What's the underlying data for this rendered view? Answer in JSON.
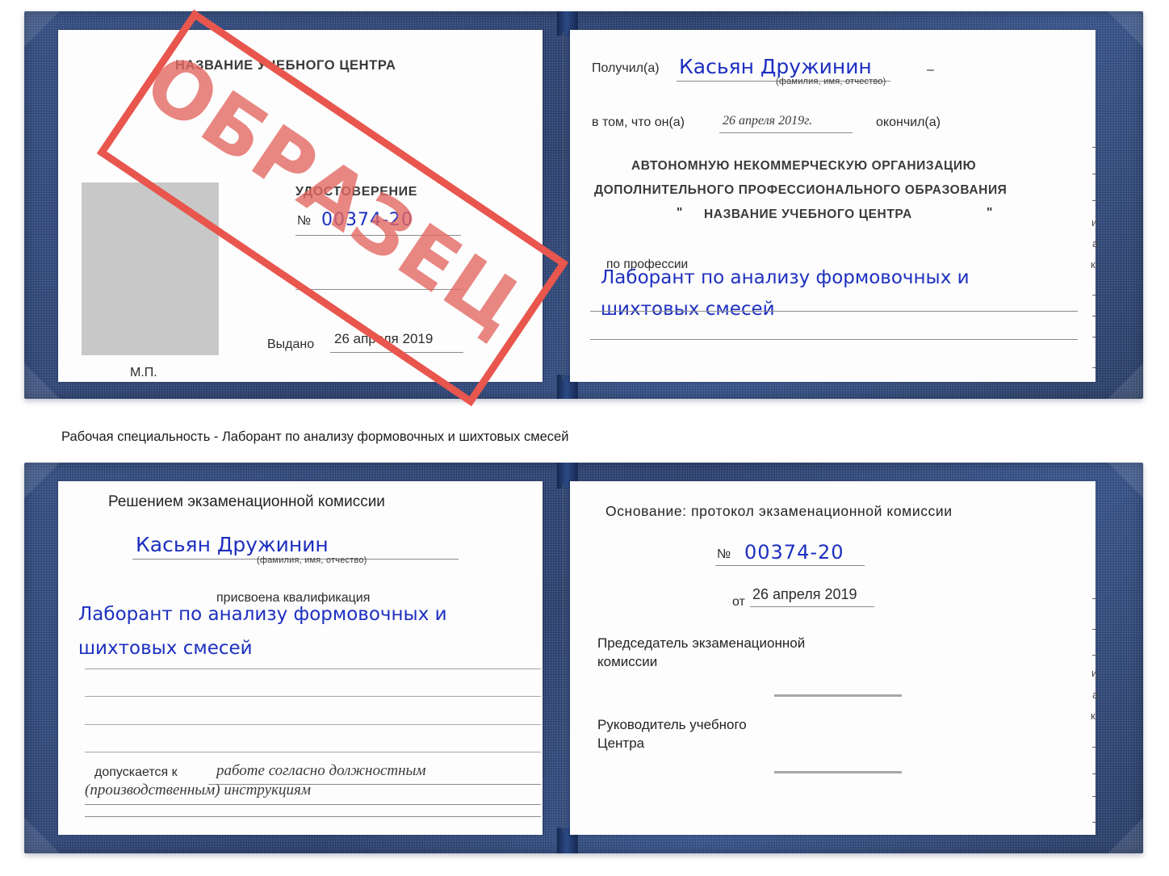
{
  "caption": "Рабочая специальность - Лаборант по анализу формовочных и шихтовых смесей",
  "colors": {
    "cover_blue": "#24407a",
    "stamp_red": "#e8564e",
    "ink_blue": "#1d2fc0",
    "paper": "#fdfdfd",
    "photo_placeholder": "#c8c8c8"
  },
  "stamp": {
    "text": "ОБРАЗЕЦ"
  },
  "certificate_top": {
    "left_page": {
      "center_name": "НАЗВАНИЕ УЧЕБНОГО ЦЕНТРА",
      "doc_title": "УДОСТОВЕРЕНИЕ",
      "number_label": "№",
      "number_value": "00374-20",
      "issued_label": "Выдано",
      "issued_value": "26 апреля 2019",
      "seal_label": "М.П."
    },
    "right_page": {
      "received_label": "Получил(а)",
      "received_value": "Касьян Дружинин",
      "received_hint": "(фамилия, имя, отчество)",
      "dash_mark": "–",
      "in_that_label": "в том, что он(а)",
      "completion_date": "26 апреля 2019г.",
      "finished_label": "окончил(а)",
      "org_line1": "АВТОНОМНУЮ НЕКОММЕРЧЕСКУЮ ОРГАНИЗАЦИЮ",
      "org_line2": "ДОПОЛНИТЕЛЬНОГО ПРОФЕССИОНАЛЬНОГО ОБРАЗОВАНИЯ",
      "org_quote_open": "\"",
      "org_line3": "НАЗВАНИЕ УЧЕБНОГО ЦЕНТРА",
      "org_quote_close": "\"",
      "profession_label": "по профессии",
      "profession_line1": "Лаборант по анализу формовочных и",
      "profession_line2": "шихтовых смесей"
    }
  },
  "certificate_bottom": {
    "left_page": {
      "decision_label": "Решением экзаменационной комиссии",
      "name_value": "Касьян Дружинин",
      "name_hint": "(фамилия, имя, отчество)",
      "qualification_label": "присвоена квалификация",
      "qualification_line1": "Лаборант по анализу формовочных и",
      "qualification_line2": "шихтовых смесей",
      "admitted_label": "допускается к",
      "admitted_line1": "работе согласно должностным",
      "admitted_line2": "(производственным) инструкциям"
    },
    "right_page": {
      "basis_label": "Основание: протокол экзаменационной комиссии",
      "number_label": "№",
      "number_value": "00374-20",
      "date_label": "от",
      "date_value": "26 апреля 2019",
      "chairman_line1": "Председатель экзаменационной",
      "chairman_line2": "комиссии",
      "head_line1": "Руководитель учебного",
      "head_line2": "Центра"
    }
  },
  "bleed_fragments_top": [
    "–",
    "–",
    "–",
    "и",
    "а",
    "к-",
    "–",
    "–",
    "–",
    "–"
  ],
  "bleed_fragments_bottom": [
    "–",
    "–",
    "–",
    "и",
    "а",
    "к-",
    "–",
    "–",
    "–",
    "–"
  ]
}
